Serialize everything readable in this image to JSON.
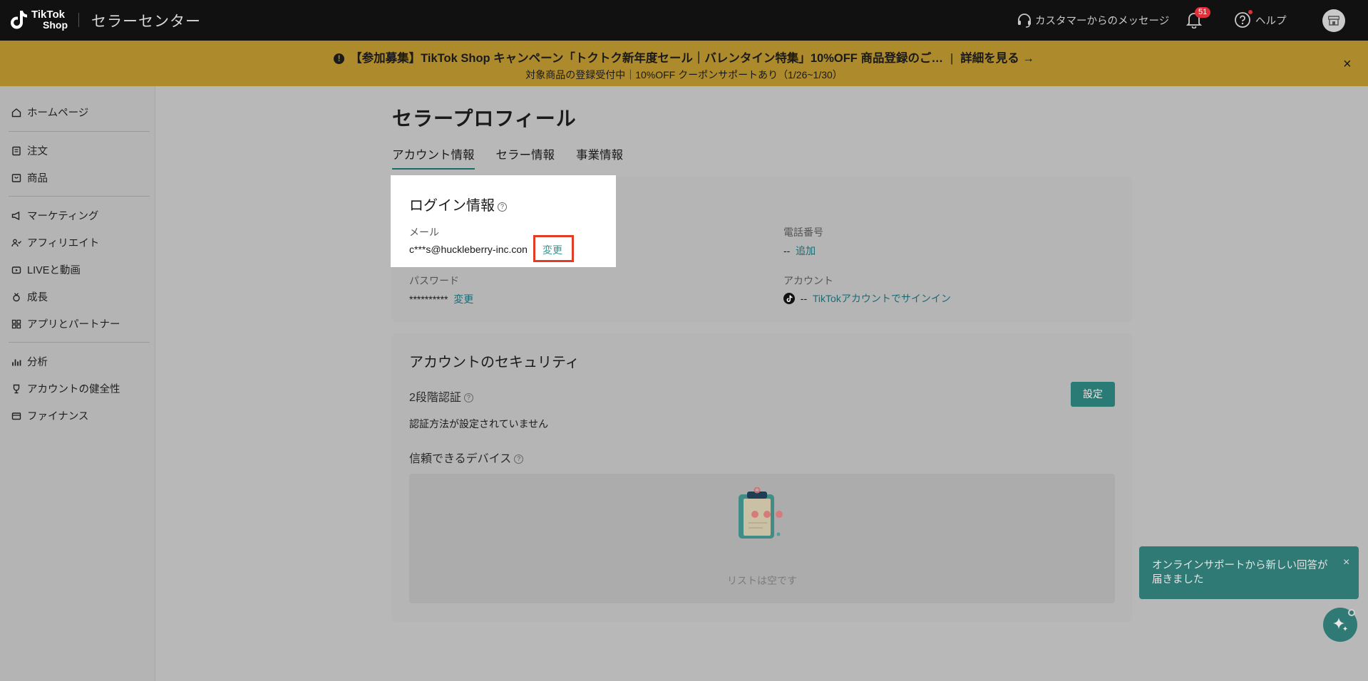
{
  "topbar": {
    "logo_line1": "TikTok",
    "logo_line2": "Shop",
    "title": "セラーセンター",
    "messages_label": "カスタマーからのメッセージ",
    "notification_count": "51",
    "help_label": "ヘルプ"
  },
  "banner": {
    "icon": "exclamation-icon",
    "headline": "【参加募集】TikTok Shop キャンペーン「トクトク新年度セール｜バレンタイン特集」10%OFF 商品登録のご…",
    "separator": "|",
    "details_link": "詳細を見る →",
    "subline": "対象商品の登録受付中｜10%OFF クーポンサポートあり（1/26~1/30）",
    "close": "×"
  },
  "sidebar": {
    "items": [
      {
        "label": "ホームページ",
        "icon": "home-icon"
      },
      {
        "label": "注文",
        "icon": "order-icon"
      },
      {
        "label": "商品",
        "icon": "product-icon"
      },
      {
        "label": "マーケティング",
        "icon": "megaphone-icon"
      },
      {
        "label": "アフィリエイト",
        "icon": "affiliate-icon"
      },
      {
        "label": "LIVEと動画",
        "icon": "video-icon"
      },
      {
        "label": "成長",
        "icon": "medal-icon"
      },
      {
        "label": "アプリとパートナー",
        "icon": "apps-icon"
      },
      {
        "label": "分析",
        "icon": "chart-icon"
      },
      {
        "label": "アカウントの健全性",
        "icon": "trophy-icon"
      },
      {
        "label": "ファイナンス",
        "icon": "wallet-icon"
      }
    ]
  },
  "main": {
    "page_title": "セラープロフィール",
    "tabs": [
      {
        "label": "アカウント情報"
      },
      {
        "label": "セラー情報"
      },
      {
        "label": "事業情報"
      }
    ],
    "login_info": {
      "title": "ログイン情報",
      "email_label": "メール",
      "email_value": "c***s@huckleberry-inc.con",
      "email_change": "変更",
      "phone_label": "電話番号",
      "phone_value": "--",
      "phone_add": "追加",
      "password_label": "パスワード",
      "password_value": "**********",
      "password_change": "変更",
      "account_label": "アカウント",
      "account_value": "--",
      "account_signin": "TikTokアカウントでサインイン"
    },
    "security": {
      "title": "アカウントのセキュリティ",
      "two_factor_label": "2段階認証",
      "setup_button": "設定",
      "two_factor_status": "認証方法が設定されていません",
      "trusted_devices_label": "信頼できるデバイス",
      "empty_text": "リストは空です"
    }
  },
  "toast": {
    "text": "オンラインサポートから新しい回答が届きました",
    "close": "×"
  },
  "colors": {
    "accent": "#2a7b76",
    "link": "#1c6b73",
    "banner": "#ad8a2c",
    "highlight_border": "#e03c26"
  }
}
